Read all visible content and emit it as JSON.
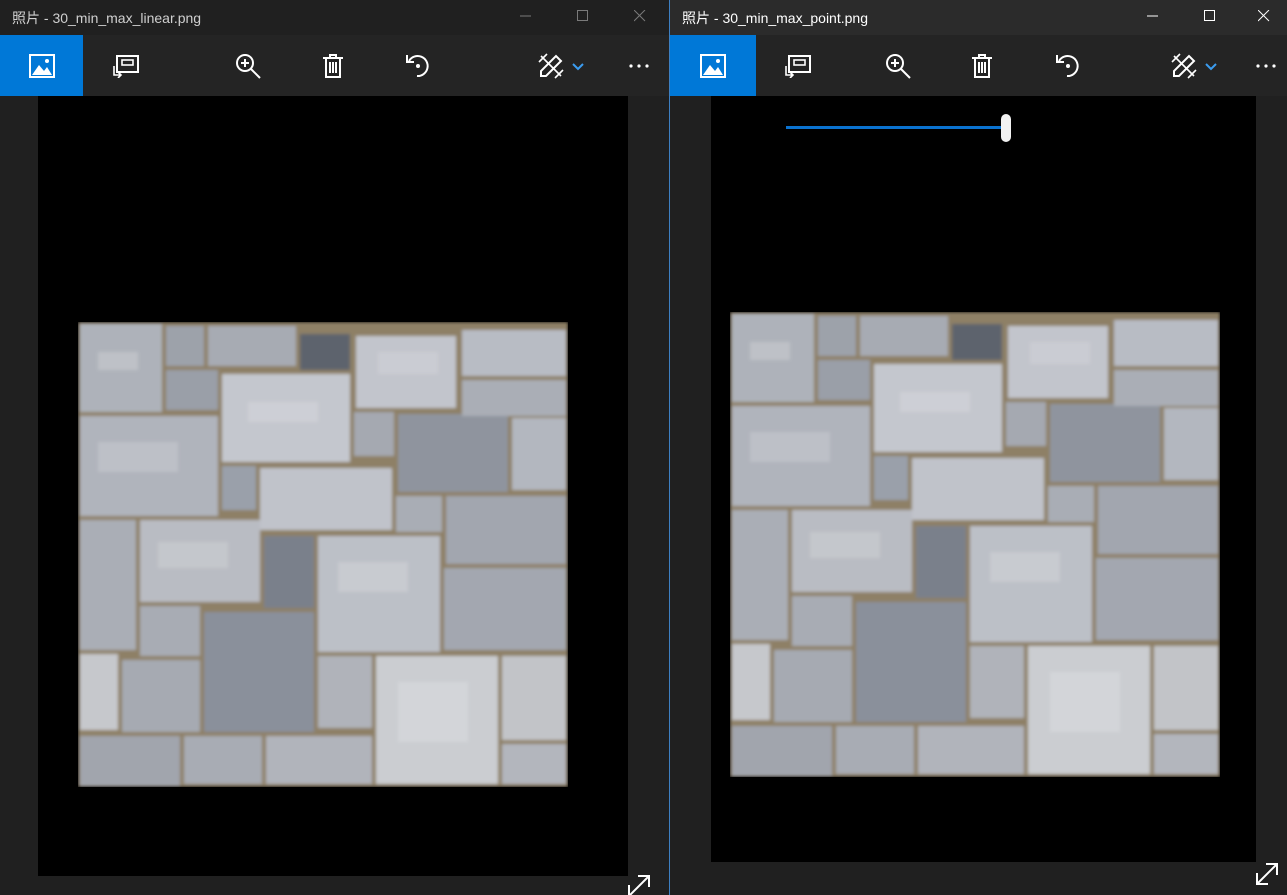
{
  "windows": [
    {
      "title": "照片 - 30_min_max_linear.png",
      "toolbar": {
        "items": [
          "picture-icon",
          "slideshow-icon",
          "zoom-in-icon",
          "delete-icon",
          "rotate-icon",
          "edit-icon",
          "more-icon"
        ]
      }
    },
    {
      "title": "照片 - 30_min_max_point.png",
      "toolbar": {
        "items": [
          "picture-icon",
          "slideshow-icon",
          "zoom-in-icon",
          "delete-icon",
          "rotate-icon",
          "edit-icon",
          "more-icon"
        ]
      },
      "zoom_slider": {
        "value_percent": 100
      }
    }
  ],
  "colors": {
    "accent": "#0078d7",
    "titlebar_active": "#2b2b2b",
    "titlebar_inactive": "#202020",
    "canvas": "#000000"
  }
}
